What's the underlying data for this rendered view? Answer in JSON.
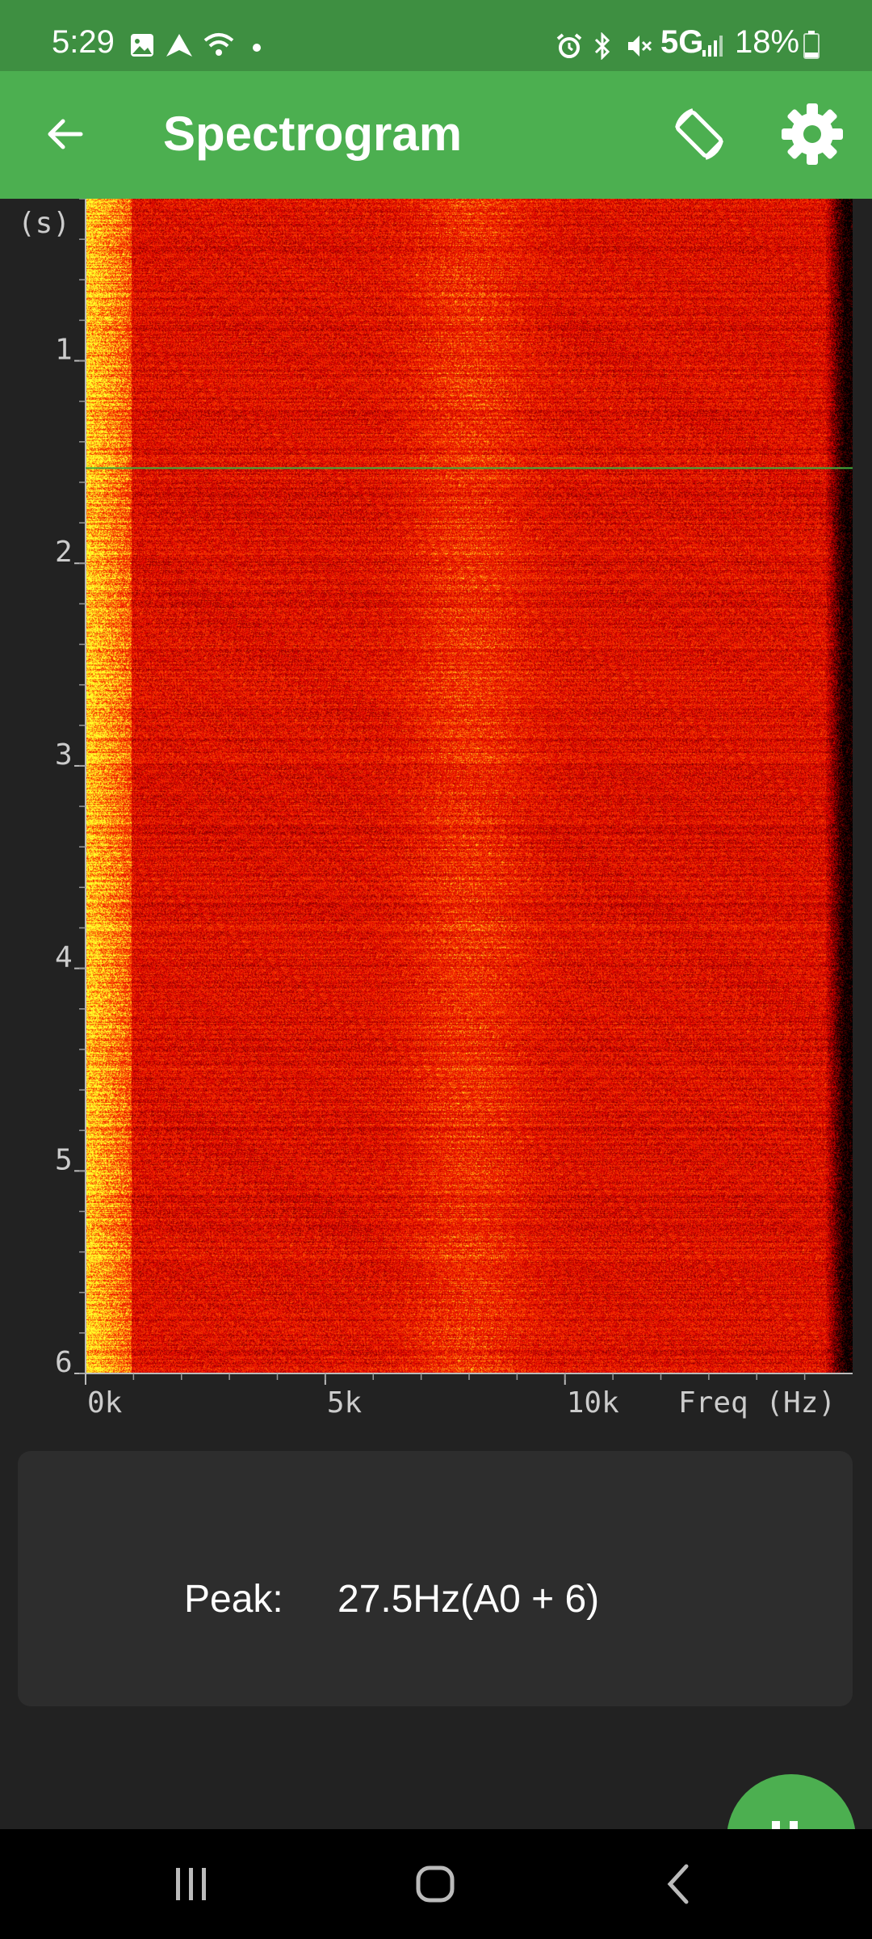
{
  "status_bar": {
    "time": "5:29",
    "network": "5G",
    "battery": "18%",
    "icons": [
      "image-icon",
      "navigation-icon",
      "wifi-icon",
      "dot-icon",
      "alarm-icon",
      "bluetooth-icon",
      "mute-icon",
      "signal-icon",
      "battery-icon"
    ]
  },
  "app_bar": {
    "title": "Spectrogram",
    "icons": [
      "back-arrow-icon",
      "screen-rotation-icon",
      "gear-icon"
    ]
  },
  "colors": {
    "status_bar": "#3e8f41",
    "app_bar": "#4caf50",
    "background": "#222222",
    "card": "#2d2d2d",
    "marker_line": "#3fae3f"
  },
  "chart_data": {
    "type": "heatmap",
    "x_axis_label": "Freq (Hz)",
    "y_axis_label": "(s)",
    "x_tick_labels": [
      "0k",
      "5k",
      "10k"
    ],
    "x_ticks": [
      0,
      5000,
      10000
    ],
    "xlim": [
      0,
      16000
    ],
    "y_tick_labels": [
      "1",
      "2",
      "3",
      "4",
      "5",
      "6"
    ],
    "y_ticks": [
      1,
      2,
      3,
      4,
      5,
      6
    ],
    "ylim": [
      0.2,
      6
    ],
    "marker_time": 1.53,
    "colormap": "black-red-yellow"
  },
  "info": {
    "peak_label": "Peak:",
    "peak_value": "27.5Hz(A0 + 6)"
  },
  "nav_bar": {
    "icons": [
      "recent-apps-icon",
      "home-icon",
      "back-icon"
    ]
  }
}
